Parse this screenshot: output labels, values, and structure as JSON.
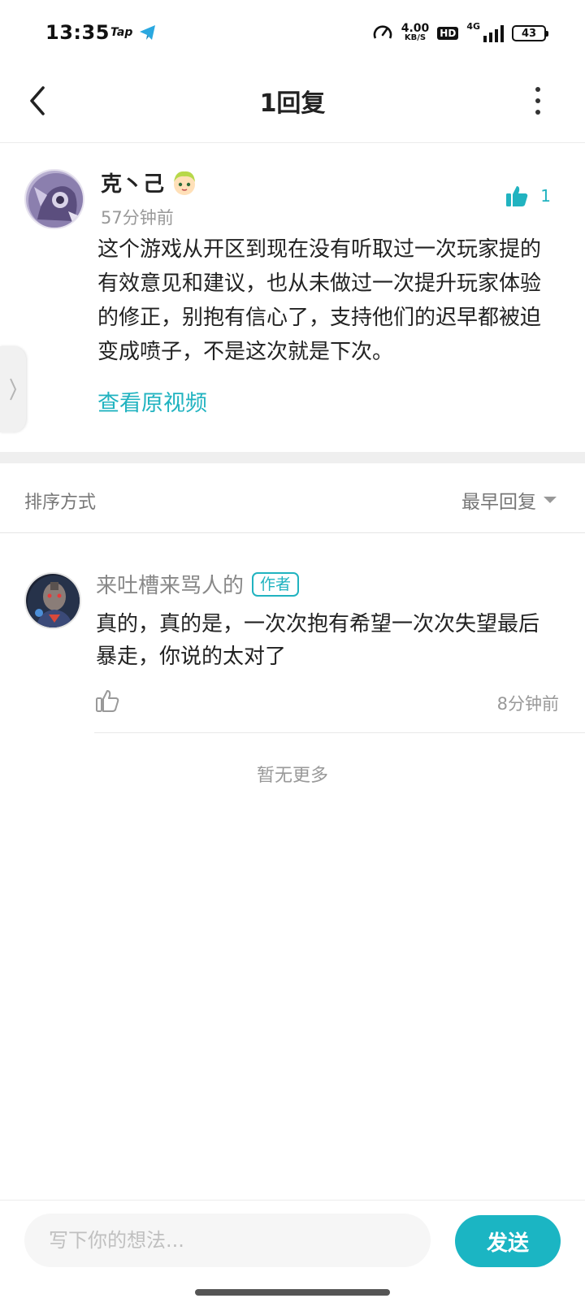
{
  "status_bar": {
    "time": "13:35",
    "app_tag": "Tap",
    "net_speed": "4.00",
    "net_speed_unit": "KB/S",
    "hd": "HD",
    "network": "4G",
    "battery": "43",
    "icons": [
      "telegram-icon",
      "speedometer-icon",
      "signal-icon",
      "battery-icon"
    ]
  },
  "header": {
    "title": "1回复",
    "back_icon": "chevron-left-icon",
    "more_icon": "more-vertical-icon"
  },
  "post": {
    "username": "克丶己",
    "time": "57分钟前",
    "like_count": "1",
    "body": "这个游戏从开区到现在没有听取过一次玩家提的有效意见和建议，也从未做过一次提升玩家体验的修正，别抱有信心了，支持他们的迟早都被迫变成喷子，不是这次就是下次。",
    "view_video": "查看原视频"
  },
  "sort": {
    "label": "排序方式",
    "value": "最早回复"
  },
  "reply": {
    "username": "来吐槽来骂人的",
    "badge": "作者",
    "body": "真的，真的是，一次次抱有希望一次次失望最后暴走，你说的太对了",
    "time": "8分钟前"
  },
  "no_more": "暂无更多",
  "composer": {
    "placeholder": "写下你的想法...",
    "send_label": "发送"
  },
  "colors": {
    "accent": "#1bb5c3",
    "muted_text": "#999999",
    "divider": "#efefef"
  }
}
